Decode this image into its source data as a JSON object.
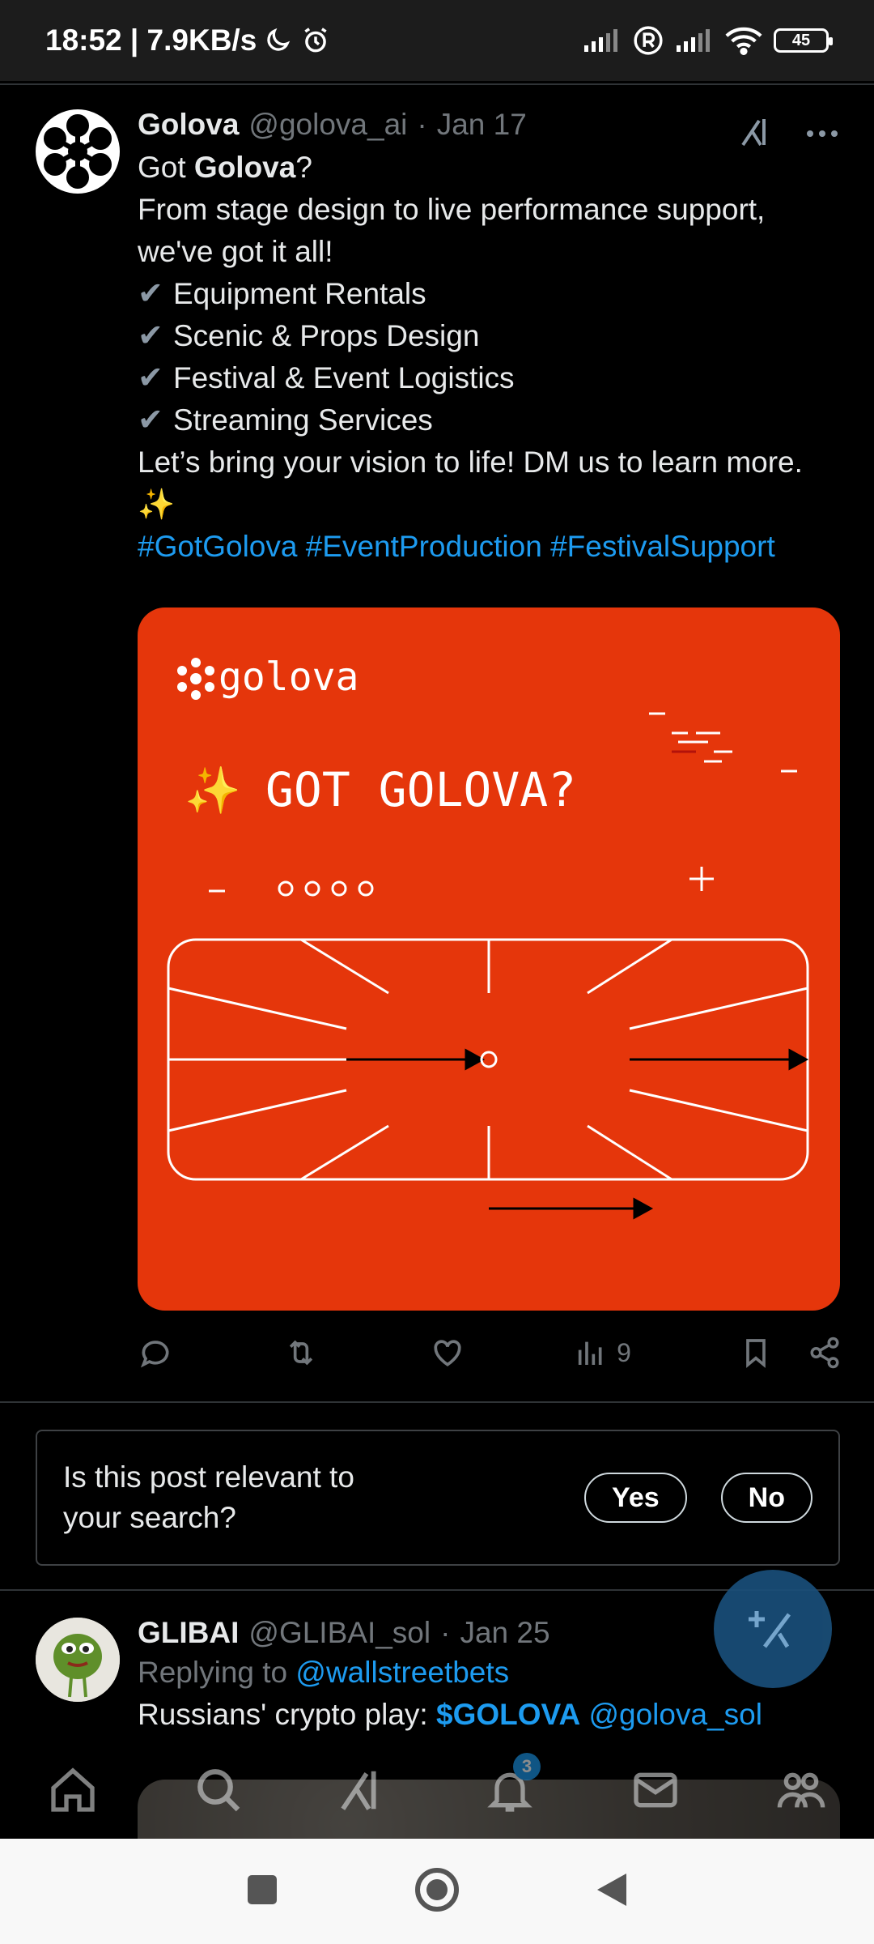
{
  "status_bar": {
    "time_speed": "18:52 | 7.9KB/s",
    "battery": "45"
  },
  "post": {
    "author_name": "Golova",
    "handle": "@golova_ai",
    "separator": "·",
    "date": "Jan 17",
    "intro_prefix": "Got ",
    "intro_bold": "Golova",
    "intro_suffix": "?",
    "line2": "From stage design to live performance support, we've got it all!",
    "checklist": [
      "Equipment Rentals",
      "Scenic & Props Design",
      "Festival & Event Logistics",
      "Streaming Services"
    ],
    "cta": "Let’s bring your vision to life! DM us to learn more. ✨",
    "hashtags": "#GotGolova #EventProduction #FestivalSupport",
    "media": {
      "logo_text": "golova",
      "headline": "GOT GOLOVA?",
      "sparkle": "✨",
      "accent_color": "#e5360b"
    },
    "actions": {
      "views_count": "9"
    }
  },
  "relevance": {
    "question": "Is this post relevant to your search?",
    "yes_label": "Yes",
    "no_label": "No"
  },
  "post2": {
    "author_name": "GLIBAI",
    "handle": "@GLIBAI_sol",
    "separator": "·",
    "date": "Jan 25",
    "replying_prefix": "Replying to ",
    "replying_to": "@wallstreetbets",
    "text_prefix": "Russians' crypto play: ",
    "cashtag": "$GOLOVA",
    "mention": "@golova_sol"
  },
  "tabbar": {
    "notifications_badge": "3"
  },
  "colors": {
    "link": "#1d9bf0",
    "muted": "#71767b",
    "background": "#000000"
  }
}
